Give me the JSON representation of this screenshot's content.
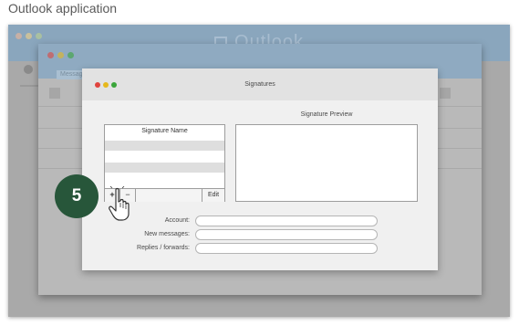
{
  "caption": "Outlook application",
  "background_app": {
    "title": "Outlook",
    "tab_label": "Messag"
  },
  "dialog": {
    "title": "Signatures",
    "signature_name_header": "Signature Name",
    "add_button": "+",
    "remove_button": "−",
    "edit_button": "Edit",
    "preview_label": "Signature Preview",
    "fields": {
      "account_label": "Account:",
      "new_messages_label": "New messages:",
      "replies_label": "Replies / forwards:"
    }
  },
  "step_badge": "5",
  "colors": {
    "badge": "#27563a",
    "close": "#e0443e",
    "minimize": "#e6b81c",
    "zoom": "#3aa53a",
    "title_bar": "#8aa6bd"
  },
  "icons": {
    "pointer": "hand-pointer-icon"
  }
}
